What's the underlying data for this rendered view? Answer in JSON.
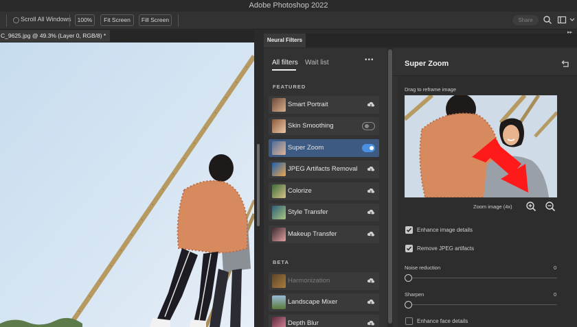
{
  "app": {
    "title": "Adobe Photoshop 2022"
  },
  "options_bar": {
    "scroll_all_windows": "Scroll All Windows",
    "zoom_100": "100%",
    "fit_screen": "Fit Screen",
    "fill_screen": "Fill Screen",
    "share": "Share"
  },
  "document": {
    "tab_title": "C_9625.jpg @ 49.3% (Layer 0, RGB/8) *"
  },
  "neural_filters": {
    "panel_title": "Neural Filters",
    "tabs": {
      "all": "All filters",
      "wait": "Wait list",
      "more": "•••"
    },
    "featured_heading": "FEATURED",
    "beta_heading": "BETA",
    "featured": [
      {
        "label": "Smart Portrait",
        "control": "cloud"
      },
      {
        "label": "Skin Smoothing",
        "control": "toggle-off"
      },
      {
        "label": "Super Zoom",
        "control": "toggle-on"
      },
      {
        "label": "JPEG Artifacts Removal",
        "control": "cloud"
      },
      {
        "label": "Colorize",
        "control": "cloud"
      },
      {
        "label": "Style Transfer",
        "control": "cloud"
      },
      {
        "label": "Makeup Transfer",
        "control": "cloud"
      }
    ],
    "beta": [
      {
        "label": "Harmonization",
        "control": "cloud",
        "disabled": true
      },
      {
        "label": "Landscape Mixer",
        "control": "cloud"
      },
      {
        "label": "Depth Blur",
        "control": "cloud"
      }
    ],
    "settings": {
      "title": "Super Zoom",
      "drag_hint": "Drag to reframe image",
      "zoom_label": "Zoom image (4x)",
      "enhance_details": "Enhance image details",
      "enhance_details_checked": true,
      "remove_jpeg": "Remove JPEG artifacts",
      "remove_jpeg_checked": true,
      "noise_label": "Noise reduction",
      "noise_value": "0",
      "sharpen_label": "Sharpen",
      "sharpen_value": "0",
      "enhance_face": "Enhance face details",
      "enhance_face_checked": false
    }
  },
  "colors": {
    "accent": "#4a90e2",
    "active_row": "#3d5a82",
    "annotation_arrow": "#ff1a1a"
  }
}
